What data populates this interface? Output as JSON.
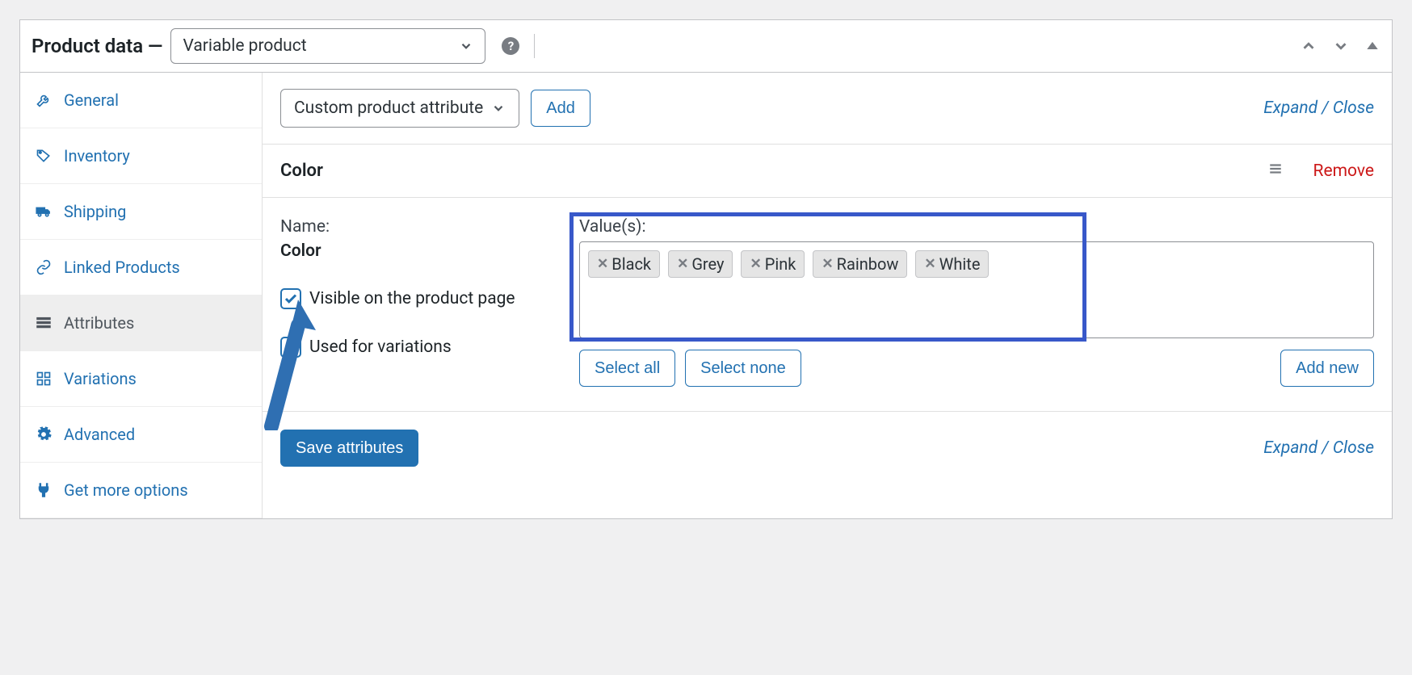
{
  "header": {
    "title": "Product data —",
    "product_type": "Variable product"
  },
  "sidebar": {
    "items": [
      {
        "label": "General"
      },
      {
        "label": "Inventory"
      },
      {
        "label": "Shipping"
      },
      {
        "label": "Linked Products"
      },
      {
        "label": "Attributes"
      },
      {
        "label": "Variations"
      },
      {
        "label": "Advanced"
      },
      {
        "label": "Get more options"
      }
    ]
  },
  "toolbar": {
    "attribute_select": "Custom product attribute",
    "add_label": "Add",
    "expand_close": "Expand / Close"
  },
  "attribute": {
    "title": "Color",
    "remove_label": "Remove",
    "name_label": "Name:",
    "name_value": "Color",
    "visible_label": "Visible on the product page",
    "used_variations_label": "Used for variations",
    "values_label": "Value(s):",
    "tags": [
      "Black",
      "Grey",
      "Pink",
      "Rainbow",
      "White"
    ],
    "select_all": "Select all",
    "select_none": "Select none",
    "add_new": "Add new"
  },
  "footer": {
    "save_label": "Save attributes",
    "expand_close": "Expand / Close"
  }
}
